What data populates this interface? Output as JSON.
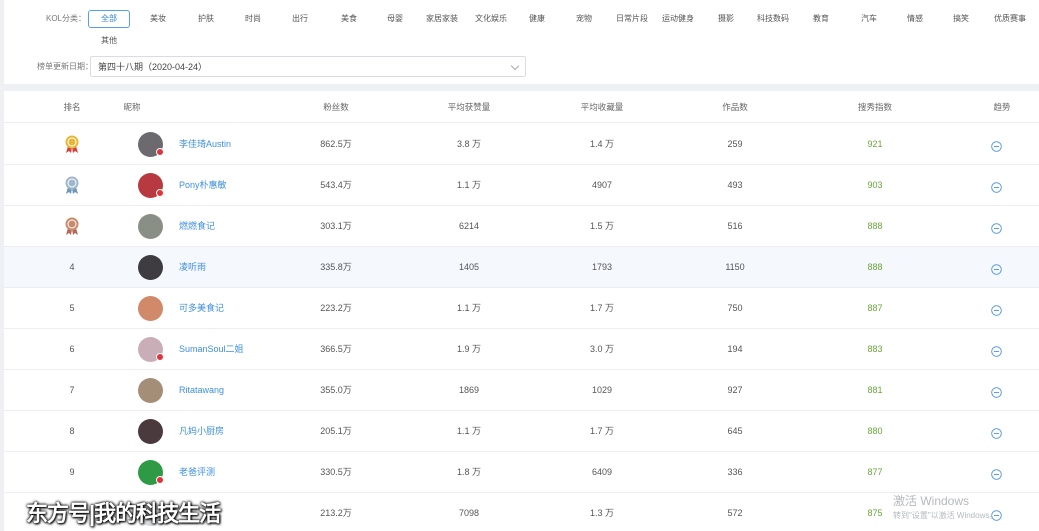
{
  "filters": {
    "category_label": "KOL分类：",
    "categories": [
      "全部",
      "美妆",
      "护肤",
      "时尚",
      "出行",
      "美食",
      "母婴",
      "家居家装",
      "文化娱乐",
      "健康",
      "宠物",
      "日常片段",
      "运动健身",
      "摄影",
      "科技数码",
      "教育",
      "汽车",
      "情感",
      "搞笑",
      "优质赛事",
      "其他"
    ],
    "active_category": "全部",
    "date_label": "榜单更新日期：",
    "date_value": "第四十八期（2020-04-24）"
  },
  "table": {
    "columns": [
      "排名",
      "昵称",
      "粉丝数",
      "平均获赞量",
      "平均收藏量",
      "作品数",
      "搜秀指数",
      "趋势"
    ],
    "rows": [
      {
        "rank": "",
        "medal": "gold-medal-icon",
        "nickname": "李佳琦Austin",
        "followers": "862.5万",
        "avg_likes": "3.8 万",
        "avg_favorites": "1.4 万",
        "works": "259",
        "index": "921",
        "avatar_color": "#6d6a6f",
        "verified": true
      },
      {
        "rank": "",
        "medal": "silver-medal-icon",
        "nickname": "Pony朴惠敏",
        "followers": "543.4万",
        "avg_likes": "1.1 万",
        "avg_favorites": "4907",
        "works": "493",
        "index": "903",
        "avatar_color": "#b83a40",
        "verified": true
      },
      {
        "rank": "",
        "medal": "bronze-medal-icon",
        "nickname": "燃燃食记",
        "followers": "303.1万",
        "avg_likes": "6214",
        "avg_favorites": "1.5 万",
        "works": "516",
        "index": "888",
        "avatar_color": "#8a8f86",
        "verified": false
      },
      {
        "rank": "4",
        "medal": "",
        "nickname": "凌听雨",
        "followers": "335.8万",
        "avg_likes": "1405",
        "avg_favorites": "1793",
        "works": "1150",
        "index": "888",
        "avatar_color": "#3e3b41",
        "verified": false
      },
      {
        "rank": "5",
        "medal": "",
        "nickname": "可多美食记",
        "followers": "223.2万",
        "avg_likes": "1.1 万",
        "avg_favorites": "1.7 万",
        "works": "750",
        "index": "887",
        "avatar_color": "#d08a6a",
        "verified": false
      },
      {
        "rank": "6",
        "medal": "",
        "nickname": "SumanSoul二姐",
        "followers": "366.5万",
        "avg_likes": "1.9 万",
        "avg_favorites": "3.0 万",
        "works": "194",
        "index": "883",
        "avatar_color": "#c9aeb8",
        "verified": true
      },
      {
        "rank": "7",
        "medal": "",
        "nickname": "Ritatawang",
        "followers": "355.0万",
        "avg_likes": "1869",
        "avg_favorites": "1029",
        "works": "927",
        "index": "881",
        "avatar_color": "#a58e78",
        "verified": false
      },
      {
        "rank": "8",
        "medal": "",
        "nickname": "凡妈小厨房",
        "followers": "205.1万",
        "avg_likes": "1.1 万",
        "avg_favorites": "1.7 万",
        "works": "645",
        "index": "880",
        "avatar_color": "#4a3a3d",
        "verified": false
      },
      {
        "rank": "9",
        "medal": "",
        "nickname": "老爸评测",
        "followers": "330.5万",
        "avg_likes": "1.8 万",
        "avg_favorites": "6409",
        "works": "336",
        "index": "877",
        "avatar_color": "#2f9a45",
        "verified": true
      },
      {
        "rank": "",
        "medal": "",
        "nickname": "",
        "followers": "213.2万",
        "avg_likes": "7098",
        "avg_favorites": "1.3 万",
        "works": "572",
        "index": "875",
        "avatar_color": "#d9dadd",
        "verified": false
      }
    ]
  },
  "watermark": "东方号|我的科技生活",
  "windows_activation": {
    "title": "激活 Windows",
    "subtitle": "转到\"设置\"以激活 Windows。"
  }
}
